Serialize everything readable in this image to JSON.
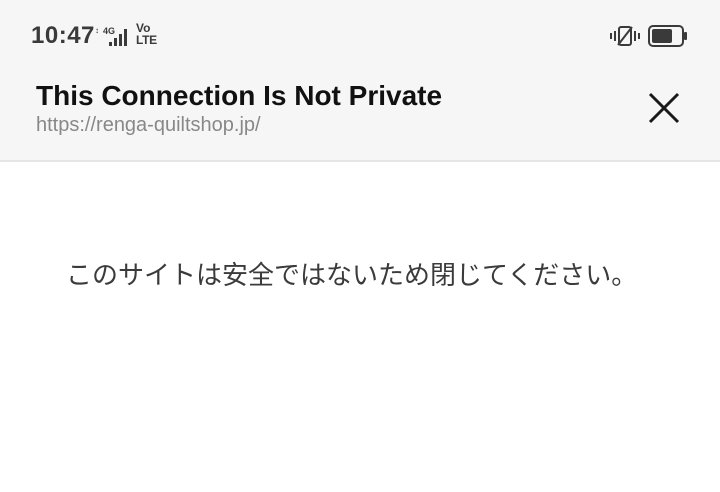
{
  "status_bar": {
    "time": "10:47",
    "network_label": "4G",
    "volte_top": "Vo",
    "volte_bottom": "LTE",
    "icons": [
      "signal-icon",
      "vibrate-icon",
      "battery-icon"
    ],
    "battery_level": 0.7
  },
  "header": {
    "title": "This Connection Is Not Private",
    "url": "https://renga-quiltshop.jp/",
    "close_icon": "close-icon"
  },
  "main": {
    "message": "このサイトは安全ではないため閉じてください。"
  }
}
